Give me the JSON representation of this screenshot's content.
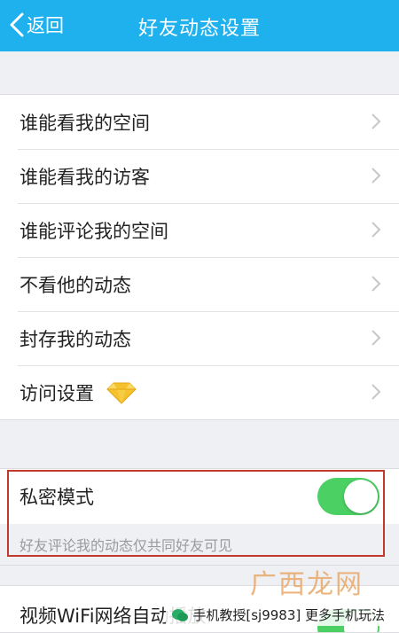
{
  "header": {
    "back_label": "返回",
    "title": "好友动态设置"
  },
  "settings": {
    "items": [
      {
        "label": "谁能看我的空间"
      },
      {
        "label": "谁能看我的访客"
      },
      {
        "label": "谁能评论我的空间"
      },
      {
        "label": "不看他的动态"
      },
      {
        "label": "封存我的动态"
      },
      {
        "label": "访问设置"
      }
    ]
  },
  "private_mode": {
    "label": "私密模式",
    "enabled": true,
    "hint": "好友评论我的动态仅共同好友可见"
  },
  "video": {
    "label": "视频WiFi网络自动播放",
    "enabled": true
  },
  "colors": {
    "nav_bg": "#1fb1ee",
    "toggle_on": "#4bd063",
    "highlight": "#c0392b",
    "diamond": "#f5c22e"
  },
  "watermark": {
    "text": "手机教授[sj9983] 更多手机玩法",
    "brand": "广西龙网"
  }
}
